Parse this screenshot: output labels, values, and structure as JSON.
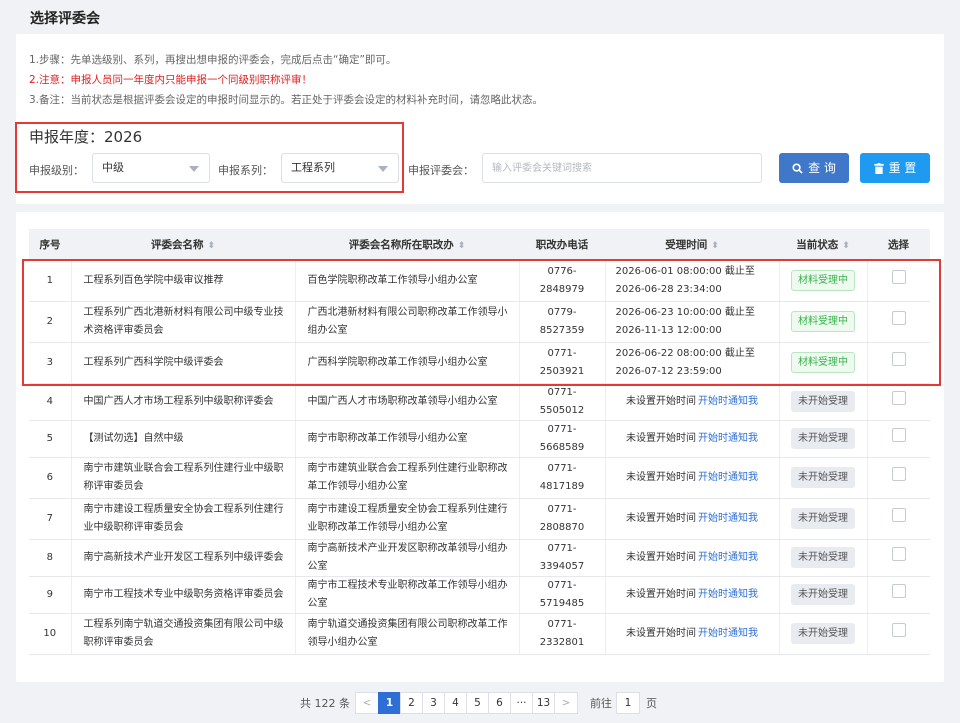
{
  "page": {
    "title": "选择评委会"
  },
  "notes": {
    "step": "1.步骤：先单选级别、系列，再搜出想申报的评委会，完成后点击“确定”即可。",
    "warning": "2.注意：申报人员同一年度内只能申报一个同级别职称评审！",
    "remark": "3.备注：当前状态是根据评委会设定的申报时间显示的。若正处于评委会设定的材料补充时间，请忽略此状态。"
  },
  "filters": {
    "year_label": "申报年度：2026",
    "level_label": "申报级别：",
    "level_value": "中级",
    "series_label": "申报系列：",
    "series_value": "工程系列",
    "committee_label": "申报评委会：",
    "committee_placeholder": "输入评委会关键词搜索",
    "query_button": "查 询",
    "reset_button": "重 置"
  },
  "table": {
    "headers": [
      "序号",
      "评委会名称",
      "评委会名称所在职改办",
      "职改办电话",
      "受理时间",
      "当前状态",
      "选择"
    ],
    "notify_label": "开始时通知我",
    "rows": [
      {
        "no": "1",
        "name": "工程系列百色学院中级审议推荐",
        "office": "百色学院职称改革工作领导小组办公室",
        "phone": "0776-2848979",
        "time": "2026-06-01 08:00:00 截止至 2026-06-28 23:34:00",
        "status": "材料受理中",
        "status_type": "green"
      },
      {
        "no": "2",
        "name": "工程系列广西北港新材料有限公司中级专业技术资格评审委员会",
        "office": "广西北港新材料有限公司职称改革工作领导小组办公室",
        "phone": "0779-8527359",
        "time": "2026-06-23 10:00:00 截止至 2026-11-13 12:00:00",
        "status": "材料受理中",
        "status_type": "green"
      },
      {
        "no": "3",
        "name": "工程系列广西科学院中级评委会",
        "office": "广西科学院职称改革工作领导小组办公室",
        "phone": "0771-2503921",
        "time": "2026-06-22 08:00:00 截止至 2026-07-12 23:59:00",
        "status": "材料受理中",
        "status_type": "green"
      },
      {
        "no": "4",
        "name": "中国广西人才市场工程系列中级职称评委会",
        "office": "中国广西人才市场职称改革领导小组办公室",
        "phone": "0771-5505012",
        "time": "未设置开始时间",
        "status": "未开始受理",
        "status_type": "gray"
      },
      {
        "no": "5",
        "name": "【测试勿选】自然中级",
        "office": "南宁市职称改革工作领导小组办公室",
        "phone": "0771-5668589",
        "time": "未设置开始时间",
        "status": "未开始受理",
        "status_type": "gray"
      },
      {
        "no": "6",
        "name": "南宁市建筑业联合会工程系列住建行业中级职称评审委员会",
        "office": "南宁市建筑业联合会工程系列住建行业职称改革工作领导小组办公室",
        "phone": "0771-4817189",
        "time": "未设置开始时间",
        "status": "未开始受理",
        "status_type": "gray"
      },
      {
        "no": "7",
        "name": "南宁市建设工程质量安全协会工程系列住建行业中级职称评审委员会",
        "office": "南宁市建设工程质量安全协会工程系列住建行业职称改革工作领导小组办公室",
        "phone": "0771-2808870",
        "time": "未设置开始时间",
        "status": "未开始受理",
        "status_type": "gray"
      },
      {
        "no": "8",
        "name": "南宁高新技术产业开发区工程系列中级评委会",
        "office": "南宁高新技术产业开发区职称改革领导小组办公室",
        "phone": "0771-3394057",
        "time": "未设置开始时间",
        "status": "未开始受理",
        "status_type": "gray"
      },
      {
        "no": "9",
        "name": "南宁市工程技术专业中级职务资格评审委员会",
        "office": "南宁市工程技术专业职称改革工作领导小组办公室",
        "phone": "0771-5719485",
        "time": "未设置开始时间",
        "status": "未开始受理",
        "status_type": "gray"
      },
      {
        "no": "10",
        "name": "工程系列南宁轨道交通投资集团有限公司中级职称评审委员会",
        "office": "南宁轨道交通投资集团有限公司职称改革工作领导小组办公室",
        "phone": "0771-2332801",
        "time": "未设置开始时间",
        "status": "未开始受理",
        "status_type": "gray"
      }
    ]
  },
  "pagination": {
    "total": "共 122 条",
    "pages": [
      "1",
      "2",
      "3",
      "4",
      "5",
      "6",
      "···",
      "13"
    ],
    "current": "1",
    "goto_label": "前往",
    "goto_value": "1",
    "page_unit": "页"
  },
  "colors": {
    "primary": "#3f78c9",
    "accent": "#1e9bf0",
    "warning": "#e02020",
    "highlight_box": "#e53935",
    "status_green": "#38b34a"
  }
}
